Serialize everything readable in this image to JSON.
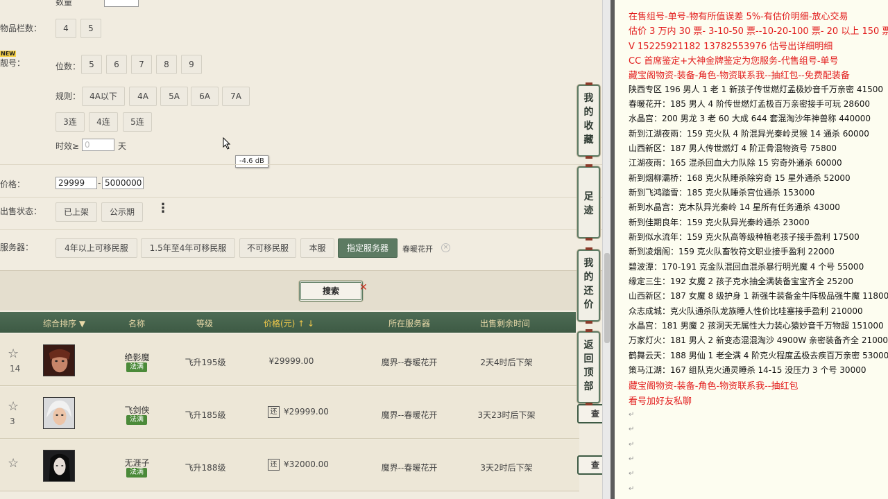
{
  "filters": {
    "top_partial": "数量",
    "slots_label": "物品栏数：",
    "slots": [
      "4",
      "5"
    ],
    "new_tag": "NEW",
    "account_label": "靓号：",
    "digits_label": "位数：",
    "digits": [
      "5",
      "6",
      "7",
      "8",
      "9"
    ],
    "rules_label": "规则：",
    "rules": [
      "4A以下",
      "4A",
      "5A",
      "6A",
      "7A"
    ],
    "consecutive": [
      "3连",
      "4连",
      "5连"
    ],
    "timeliness_label": "时效≥",
    "timeliness_value": "0",
    "timeliness_unit": "天",
    "tooltip": "-4.6 dB",
    "price_label": "价格：",
    "price_min": "29999",
    "price_sep": "-",
    "price_max": "5000000",
    "status_label": "出售状态：",
    "status_options": [
      "已上架",
      "公示期"
    ],
    "more": "⋮",
    "server_label": "服务器：",
    "server_options": [
      "4年以上可移民服",
      "1.5年至4年可移民服",
      "不可移民服",
      "本服",
      "指定服务器"
    ],
    "selected_server": "春暖花开",
    "clear_icon": "×"
  },
  "search": {
    "label": "搜索",
    "close": "✕"
  },
  "table": {
    "headers": [
      "综合排序 ▼",
      "名称",
      "等级",
      "价格(元) ↑ ↓",
      "所在服务器",
      "出售剩余时间"
    ],
    "rows": [
      {
        "count": "14",
        "name": "绝影魔",
        "badge": "法满",
        "level": "飞升195级",
        "price": "¥29999.00",
        "has_huan": false,
        "server": "魔界--春暖花开",
        "time": "2天4时后下架",
        "view": ""
      },
      {
        "count": "3",
        "name": "飞剑侠",
        "badge": "法满",
        "level": "飞升185级",
        "price": "¥29999.00",
        "has_huan": true,
        "server": "魔界--春暖花开",
        "time": "3天23时后下架",
        "view": "查"
      },
      {
        "count": "",
        "name": "无涯子",
        "badge": "法满",
        "level": "飞升188级",
        "price": "¥32000.00",
        "has_huan": true,
        "server": "魔界--春暖花开",
        "time": "3天2时后下架",
        "view": "查"
      }
    ],
    "huan": "还"
  },
  "sidetabs": [
    "我的收藏",
    "足迹",
    "我的还价",
    "返回顶部"
  ],
  "notes": [
    {
      "text": "在售组号-单号-物有所值误差 5%-有估价明细-放心交易",
      "red": true
    },
    {
      "text": "估价 3 万内 30 票- 3-10-50 票--10-20-100 票- 20 以上 150 票-1 票 1 元",
      "red": true
    },
    {
      "text": "V 15225921182    13782553976   估号出详细明细",
      "red": true
    },
    {
      "text": "CC 首席鉴定+大神金牌鉴定为您服务-代售组号-单号",
      "red": true
    },
    {
      "text": "藏宝阁物资-装备-角色-物资联系我--抽红包--免费配装备",
      "red": true
    },
    {
      "text": "陕西专区 196 男人 1 老 1 新孩子传世燃灯孟极妙音千万亲密 41500",
      "red": false
    },
    {
      "text": "春暖花开：185 男人 4 阶传世燃灯孟极百万亲密接手可玩 28600",
      "red": false
    },
    {
      "text": "水晶宫：200 男龙 3 老 60 大成 644 套混淘沙年神兽称 440000",
      "red": false
    },
    {
      "text": "新到江湖夜雨：159 克火队 4 阶混异光秦岭灵猴 14 通杀 60000",
      "red": false
    },
    {
      "text": "山西新区：187 男人传世燃灯 4 阶正骨混物资号 75800",
      "red": false
    },
    {
      "text": "江湖夜雨：165 混杀回血大力队除 15 穷奇外通杀 60000",
      "red": false
    },
    {
      "text": "新到烟柳灞桥：168 克火队睡杀除穷奇 15 星外通杀 52000",
      "red": false
    },
    {
      "text": "新到飞鸿踏雪：185 克火队睡杀宫位通杀 153000",
      "red": false
    },
    {
      "text": "新到水晶宫：克木队异光秦岭 14 星所有任务通杀 43000",
      "red": false
    },
    {
      "text": "新到佳期良年：159 克火队异光秦岭通杀 23000",
      "red": false
    },
    {
      "text": "新到似水流年：159 克火队高等级种植老孩子接手盈利 17500",
      "red": false
    },
    {
      "text": "新到凌烟阁：159 克火队畜牧符文职业接手盈利 22000",
      "red": false
    },
    {
      "text": "碧波潭：170-191 克金队混回血混杀暴行明光魔 4 个号 55000",
      "red": false
    },
    {
      "text": "缘定三生：192 女魔 2 孩子克水抽全满装备宝宝齐全 25200",
      "red": false
    },
    {
      "text": "山西新区：187 女魔 8 级护身 1 新强牛装备金牛阵极品强牛魔 11800",
      "red": false
    },
    {
      "text": "众志成城：克火队通杀队龙族睡人性价比哇塞接手盈利 210000",
      "red": false
    },
    {
      "text": "水晶宫：181 男魔 2 孩洞天无属性大力装心猿妙音千万物超 151000",
      "red": false
    },
    {
      "text": "万家灯火：181 男人 2 新变态混混淘沙 4900W 亲密装备齐全 210000",
      "red": false
    },
    {
      "text": "鹤舞云天：188 男仙 1 老全满 4 阶克火程度孟极去疾百万亲密 53000",
      "red": false
    },
    {
      "text": "策马江湖：167 组队克火通灵睡杀 14-15 没压力 3 个号 30000",
      "red": false
    },
    {
      "text": "藏宝阁物资-装备-角色-物资联系我--抽红包",
      "red": true
    },
    {
      "text": "看号加好友私聊",
      "red": true
    }
  ],
  "return_mark": "↵"
}
